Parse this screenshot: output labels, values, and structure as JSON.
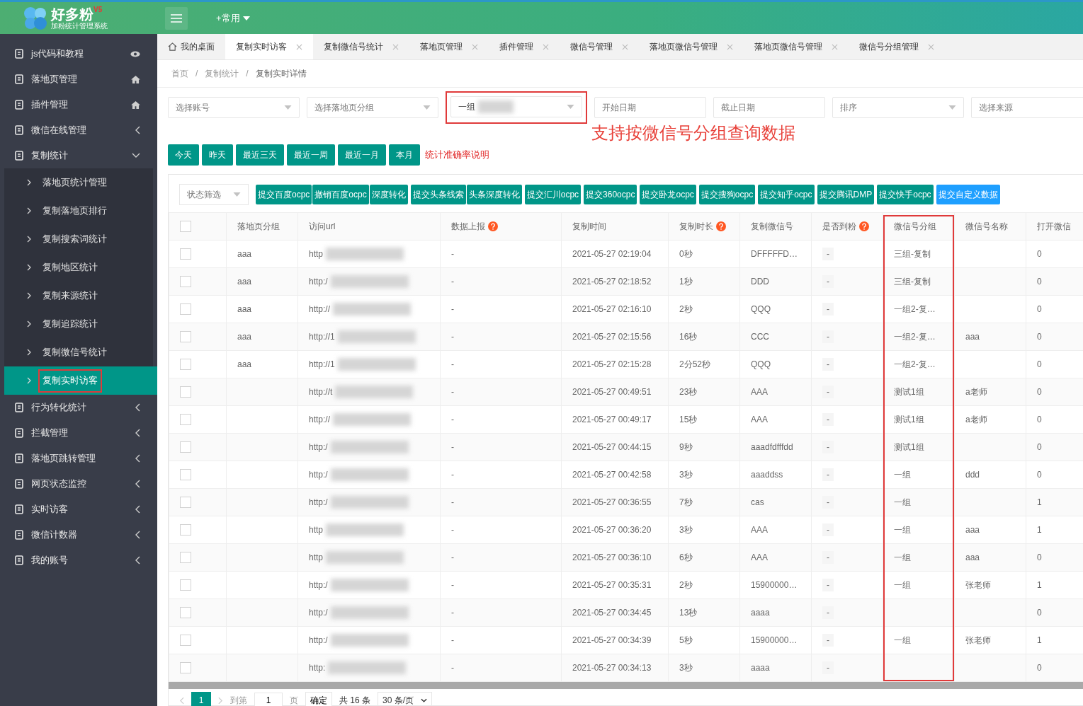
{
  "header": {
    "logo_text": "好多粉",
    "logo_badge": "V5",
    "logo_subtitle": "加粉统计管理系统",
    "quick_menu": "+常用"
  },
  "sidebar": {
    "items": [
      {
        "label": "js代码和教程"
      },
      {
        "label": "落地页管理"
      },
      {
        "label": "插件管理"
      },
      {
        "label": "微信在线管理",
        "expanded": false
      },
      {
        "label": "复制统计",
        "expanded": true,
        "children": [
          {
            "label": "落地页统计管理",
            "selected": false,
            "highlighted": false
          },
          {
            "label": "复制落地页排行",
            "selected": false,
            "highlighted": false
          },
          {
            "label": "复制搜索词统计",
            "selected": false,
            "highlighted": false
          },
          {
            "label": "复制地区统计",
            "selected": false,
            "highlighted": false
          },
          {
            "label": "复制来源统计",
            "selected": false,
            "highlighted": false
          },
          {
            "label": "复制追踪统计",
            "selected": false,
            "highlighted": false
          },
          {
            "label": "复制微信号统计",
            "selected": false,
            "highlighted": false
          },
          {
            "label": "复制实时访客",
            "selected": true,
            "highlighted": true
          }
        ]
      },
      {
        "label": "行为转化统计",
        "expanded": false
      },
      {
        "label": "拦截管理",
        "expanded": false
      },
      {
        "label": "落地页跳转管理",
        "expanded": false
      },
      {
        "label": "网页状态监控",
        "expanded": false
      },
      {
        "label": "实时访客",
        "expanded": false
      },
      {
        "label": "微信计数器",
        "expanded": false
      },
      {
        "label": "我的账号",
        "expanded": false
      }
    ]
  },
  "tabs": [
    {
      "label": "我的桌面",
      "kind": "home",
      "selected": false
    },
    {
      "label": "复制实时访客",
      "kind": "closable",
      "selected": true
    },
    {
      "label": "复制微信号统计",
      "kind": "closable",
      "selected": false
    },
    {
      "label": "落地页管理",
      "kind": "closable",
      "selected": false
    },
    {
      "label": "插件管理",
      "kind": "closable",
      "selected": false
    },
    {
      "label": "微信号管理",
      "kind": "closable",
      "selected": false
    },
    {
      "label": "落地页微信号管理",
      "kind": "closable",
      "selected": false
    },
    {
      "label": "落地页微信号管理",
      "kind": "closable",
      "selected": false
    },
    {
      "label": "微信号分组管理",
      "kind": "closable",
      "selected": false
    }
  ],
  "breadcrumb": {
    "separator": "/",
    "items": [
      "首页",
      "复制统计",
      "复制实时详情"
    ]
  },
  "filters": [
    {
      "kind": "select",
      "placeholder": "选择账号"
    },
    {
      "kind": "select",
      "placeholder": "选择落地页分组"
    },
    {
      "kind": "select",
      "value": "一组",
      "redacted": true,
      "highlighted": true
    },
    {
      "kind": "date",
      "placeholder": "开始日期"
    },
    {
      "kind": "date",
      "placeholder": "截止日期"
    },
    {
      "kind": "select",
      "placeholder": "排序"
    },
    {
      "kind": "select",
      "placeholder": "选择来源"
    }
  ],
  "annotation": "支持按微信号分组查询数据",
  "date_buttons": [
    "今天",
    "昨天",
    "最近三天",
    "最近一周",
    "最近一月",
    "本月"
  ],
  "accuracy_link": "统计准确率说明",
  "status_filter": {
    "placeholder": "状态筛选"
  },
  "actions": [
    {
      "label": "提交百度ocpc",
      "color": "#009688"
    },
    {
      "label": "撤销百度ocpc",
      "color": "#009688"
    },
    {
      "label": "深度转化",
      "color": "#009688"
    },
    {
      "label": "提交头条线索",
      "color": "#009688"
    },
    {
      "label": "头条深度转化",
      "color": "#009688"
    },
    {
      "label": "提交汇川ocpc",
      "color": "#009688"
    },
    {
      "label": "提交360ocpc",
      "color": "#009688"
    },
    {
      "label": "提交卧龙ocpc",
      "color": "#009688"
    },
    {
      "label": "提交搜狗ocpc",
      "color": "#009688"
    },
    {
      "label": "提交知乎ocpc",
      "color": "#009688"
    },
    {
      "label": "提交腾讯DMP",
      "color": "#009688"
    },
    {
      "label": "提交快手ocpc",
      "color": "#009688"
    },
    {
      "label": "提交自定义数据",
      "color": "#1e9fff"
    }
  ],
  "table": {
    "select_all_checked": false,
    "columns": [
      {
        "label": "落地页分组",
        "help": false
      },
      {
        "label": "访问url",
        "help": false
      },
      {
        "label": "数据上报",
        "help": true
      },
      {
        "label": "复制时间",
        "help": false
      },
      {
        "label": "复制时长",
        "help": true
      },
      {
        "label": "复制微信号",
        "help": false
      },
      {
        "label": "是否到粉",
        "help": true
      },
      {
        "label": "微信号分组",
        "help": false,
        "highlighted": true
      },
      {
        "label": "微信号名称",
        "help": false
      },
      {
        "label": "打开微信",
        "help": false
      }
    ],
    "rows": [
      {
        "checked": false,
        "cells": [
          "aaa",
          "http",
          "-",
          "2021-05-27 02:19:04",
          "0秒",
          "DFFFFFD…",
          "-",
          "三组-复制",
          "",
          "0"
        ]
      },
      {
        "checked": false,
        "cells": [
          "aaa",
          "http:/",
          "-",
          "2021-05-27 02:18:52",
          "1秒",
          "DDD",
          "-",
          "三组-复制",
          "",
          "0"
        ]
      },
      {
        "checked": false,
        "cells": [
          "aaa",
          "http://",
          "-",
          "2021-05-27 02:16:10",
          "2秒",
          "QQQ",
          "-",
          "一组2-复…",
          "",
          "0"
        ]
      },
      {
        "checked": false,
        "cells": [
          "aaa",
          "http://1",
          "-",
          "2021-05-27 02:15:56",
          "16秒",
          "CCC",
          "-",
          "一组2-复…",
          "aaa",
          "0"
        ]
      },
      {
        "checked": false,
        "cells": [
          "aaa",
          "http://1",
          "-",
          "2021-05-27 02:15:28",
          "2分52秒",
          "QQQ",
          "-",
          "一组2-复…",
          "",
          "0"
        ]
      },
      {
        "checked": false,
        "cells": [
          "",
          "http://t",
          "-",
          "2021-05-27 00:49:51",
          "23秒",
          "AAA",
          "-",
          "测试1组",
          "a老师",
          "0"
        ]
      },
      {
        "checked": false,
        "cells": [
          "",
          "http://",
          "-",
          "2021-05-27 00:49:17",
          "15秒",
          "AAA",
          "-",
          "测试1组",
          "a老师",
          "0"
        ]
      },
      {
        "checked": false,
        "cells": [
          "",
          "http:/",
          "-",
          "2021-05-27 00:44:15",
          "9秒",
          "aaadfdfffdd",
          "-",
          "测试1组",
          "",
          "0"
        ]
      },
      {
        "checked": false,
        "cells": [
          "",
          "http:/",
          "-",
          "2021-05-27 00:42:58",
          "3秒",
          "aaaddss",
          "-",
          "一组",
          "ddd",
          "0"
        ]
      },
      {
        "checked": false,
        "cells": [
          "",
          "http:/",
          "-",
          "2021-05-27 00:36:55",
          "7秒",
          "cas",
          "-",
          "一组",
          "",
          "1"
        ]
      },
      {
        "checked": false,
        "cells": [
          "",
          "http",
          "-",
          "2021-05-27 00:36:20",
          "3秒",
          "AAA",
          "-",
          "一组",
          "aaa",
          "1"
        ]
      },
      {
        "checked": false,
        "cells": [
          "",
          "http",
          "-",
          "2021-05-27 00:36:10",
          "6秒",
          "AAA",
          "-",
          "一组",
          "aaa",
          "0"
        ]
      },
      {
        "checked": false,
        "cells": [
          "",
          "http:/",
          "-",
          "2021-05-27 00:35:31",
          "2秒",
          "15900000…",
          "-",
          "一组",
          "张老师",
          "1"
        ]
      },
      {
        "checked": false,
        "cells": [
          "",
          "http:/",
          "-",
          "2021-05-27 00:34:45",
          "13秒",
          "aaaa",
          "-",
          "",
          "",
          "0"
        ]
      },
      {
        "checked": false,
        "cells": [
          "",
          "http:/",
          "-",
          "2021-05-27 00:34:39",
          "5秒",
          "15900000…",
          "-",
          "一组",
          "张老师",
          "1"
        ]
      },
      {
        "checked": false,
        "cells": [
          "",
          "http:",
          "-",
          "2021-05-27 00:34:13",
          "3秒",
          "aaaa",
          "-",
          "",
          "",
          "0"
        ]
      }
    ]
  },
  "pagination": {
    "pages": [
      {
        "label": "1",
        "selected": true
      }
    ],
    "goto_label": "到第",
    "goto_value": "1",
    "page_unit": "页",
    "confirm": "确定",
    "total": "共 16 条",
    "page_size": "30 条/页"
  }
}
